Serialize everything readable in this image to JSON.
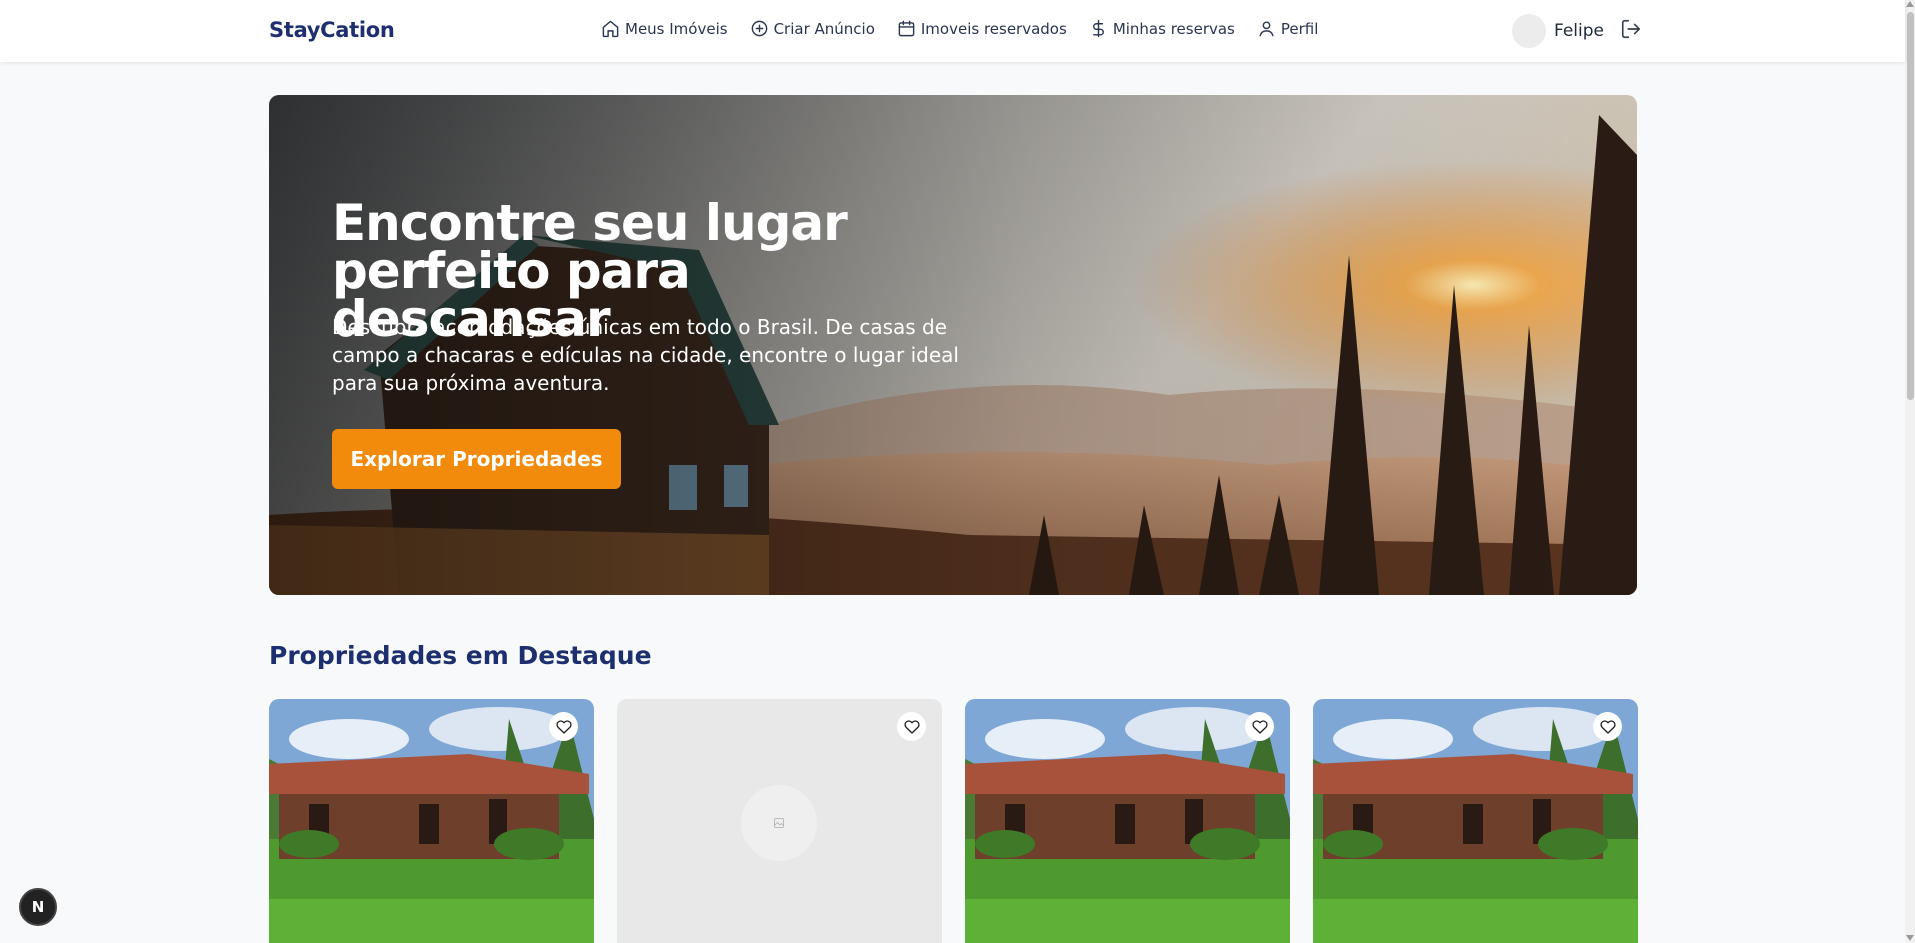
{
  "header": {
    "brand": "StayCation",
    "nav": [
      {
        "label": "Meus Imóveis",
        "icon": "home-icon"
      },
      {
        "label": "Criar Anúncio",
        "icon": "plus-circle-icon"
      },
      {
        "label": "Imoveis reservados",
        "icon": "calendar-icon"
      },
      {
        "label": "Minhas reservas",
        "icon": "dollar-icon"
      },
      {
        "label": "Perfil",
        "icon": "user-icon"
      }
    ],
    "user_name": "Felipe"
  },
  "hero": {
    "title": "Encontre seu lugar perfeito para descansar",
    "subtitle": "Descubra acomodações únicas em todo o Brasil. De casas de campo a chacaras e edículas na cidade, encontre o lugar ideal para sua próxima aventura.",
    "button": "Explorar Propriedades"
  },
  "featured": {
    "title": "Propriedades em Destaque",
    "cards": [
      {
        "image": "house-photo"
      },
      {
        "image": "placeholder"
      },
      {
        "image": "house-photo"
      },
      {
        "image": "house-photo"
      }
    ]
  },
  "badge": "N",
  "colors": {
    "brand": "#1d2f6f",
    "accent": "#f28a0b"
  }
}
